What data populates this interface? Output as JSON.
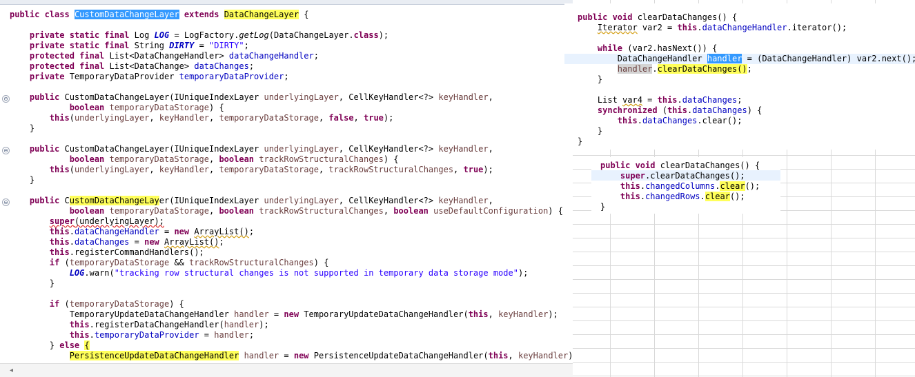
{
  "main_editor": {
    "lines": [
      [
        {
          "t": "public ",
          "c": "kw"
        },
        {
          "t": "class ",
          "c": "kw"
        },
        {
          "t": "CustomDataChangeLayer",
          "c": "sel"
        },
        {
          "t": " "
        },
        {
          "t": "extends ",
          "c": "kw"
        },
        {
          "t": "DataChangeLayer",
          "c": "hl"
        },
        {
          "t": " {"
        }
      ],
      [],
      [
        {
          "t": "    "
        },
        {
          "t": "private ",
          "c": "kw"
        },
        {
          "t": "static ",
          "c": "kw"
        },
        {
          "t": "final ",
          "c": "kw"
        },
        {
          "t": "Log "
        },
        {
          "t": "LOG",
          "c": "sfld"
        },
        {
          "t": " = LogFactory."
        },
        {
          "t": "getLog",
          "c": "sm"
        },
        {
          "t": "(DataChangeLayer."
        },
        {
          "t": "class",
          "c": "kw"
        },
        {
          "t": ");"
        }
      ],
      [
        {
          "t": "    "
        },
        {
          "t": "private ",
          "c": "kw"
        },
        {
          "t": "static ",
          "c": "kw"
        },
        {
          "t": "final ",
          "c": "kw"
        },
        {
          "t": "String "
        },
        {
          "t": "DIRTY",
          "c": "sfld"
        },
        {
          "t": " = "
        },
        {
          "t": "\"DIRTY\"",
          "c": "str"
        },
        {
          "t": ";"
        }
      ],
      [
        {
          "t": "    "
        },
        {
          "t": "protected ",
          "c": "kw"
        },
        {
          "t": "final ",
          "c": "kw"
        },
        {
          "t": "List<DataChangeHandler> "
        },
        {
          "t": "dataChangeHandler",
          "c": "fld"
        },
        {
          "t": ";"
        }
      ],
      [
        {
          "t": "    "
        },
        {
          "t": "protected ",
          "c": "kw"
        },
        {
          "t": "final ",
          "c": "kw"
        },
        {
          "t": "List<DataChange> "
        },
        {
          "t": "dataChanges",
          "c": "fld"
        },
        {
          "t": ";"
        }
      ],
      [
        {
          "t": "    "
        },
        {
          "t": "private ",
          "c": "kw"
        },
        {
          "t": "TemporaryDataProvider "
        },
        {
          "t": "temporaryDataProvider",
          "c": "fld"
        },
        {
          "t": ";"
        }
      ],
      [],
      [
        {
          "t": "    "
        },
        {
          "t": "public ",
          "c": "kw"
        },
        {
          "t": "CustomDataChangeLayer(IUniqueIndexLayer "
        },
        {
          "t": "underlyingLayer",
          "c": "par"
        },
        {
          "t": ", CellKeyHandler<?> "
        },
        {
          "t": "keyHandler",
          "c": "par"
        },
        {
          "t": ","
        }
      ],
      [
        {
          "t": "            "
        },
        {
          "t": "boolean ",
          "c": "kw"
        },
        {
          "t": "temporaryDataStorage",
          "c": "par"
        },
        {
          "t": ") {"
        }
      ],
      [
        {
          "t": "        "
        },
        {
          "t": "this",
          "c": "kw"
        },
        {
          "t": "("
        },
        {
          "t": "underlyingLayer",
          "c": "par"
        },
        {
          "t": ", "
        },
        {
          "t": "keyHandler",
          "c": "par"
        },
        {
          "t": ", "
        },
        {
          "t": "temporaryDataStorage",
          "c": "par"
        },
        {
          "t": ", "
        },
        {
          "t": "false",
          "c": "kw"
        },
        {
          "t": ", "
        },
        {
          "t": "true",
          "c": "kw"
        },
        {
          "t": ");"
        }
      ],
      [
        {
          "t": "    }"
        }
      ],
      [],
      [
        {
          "t": "    "
        },
        {
          "t": "public ",
          "c": "kw"
        },
        {
          "t": "CustomDataChangeLayer(IUniqueIndexLayer "
        },
        {
          "t": "underlyingLayer",
          "c": "par"
        },
        {
          "t": ", CellKeyHandler<?> "
        },
        {
          "t": "keyHandler",
          "c": "par"
        },
        {
          "t": ","
        }
      ],
      [
        {
          "t": "            "
        },
        {
          "t": "boolean ",
          "c": "kw"
        },
        {
          "t": "temporaryDataStorage",
          "c": "par"
        },
        {
          "t": ", "
        },
        {
          "t": "boolean ",
          "c": "kw"
        },
        {
          "t": "trackRowStructuralChanges",
          "c": "par"
        },
        {
          "t": ") {"
        }
      ],
      [
        {
          "t": "        "
        },
        {
          "t": "this",
          "c": "kw"
        },
        {
          "t": "("
        },
        {
          "t": "underlyingLayer",
          "c": "par"
        },
        {
          "t": ", "
        },
        {
          "t": "keyHandler",
          "c": "par"
        },
        {
          "t": ", "
        },
        {
          "t": "temporaryDataStorage",
          "c": "par"
        },
        {
          "t": ", "
        },
        {
          "t": "trackRowStructuralChanges",
          "c": "par"
        },
        {
          "t": ", "
        },
        {
          "t": "true",
          "c": "kw"
        },
        {
          "t": ");"
        }
      ],
      [
        {
          "t": "    }"
        }
      ],
      [],
      [
        {
          "t": "    "
        },
        {
          "t": "public ",
          "c": "kw"
        },
        {
          "t": "C"
        },
        {
          "t": "ustomDataChangeLay",
          "c": "hl"
        },
        {
          "t": "er(IUniqueIndexLayer "
        },
        {
          "t": "underlyingLayer",
          "c": "par"
        },
        {
          "t": ", CellKeyHandler<?> "
        },
        {
          "t": "keyHandler",
          "c": "par"
        },
        {
          "t": ","
        }
      ],
      [
        {
          "t": "            "
        },
        {
          "t": "boolean ",
          "c": "kw"
        },
        {
          "t": "temporaryDataStorage",
          "c": "par"
        },
        {
          "t": ", "
        },
        {
          "t": "boolean ",
          "c": "kw"
        },
        {
          "t": "trackRowStructuralChanges",
          "c": "par"
        },
        {
          "t": ", "
        },
        {
          "t": "boolean ",
          "c": "kw"
        },
        {
          "t": "useDefaultConfiguration",
          "c": "par"
        },
        {
          "t": ") {"
        }
      ],
      [
        {
          "t": "        "
        },
        {
          "t": "super",
          "c": "kw err"
        },
        {
          "t": "(underlyingLayer);",
          "c": "err"
        }
      ],
      [
        {
          "t": "        "
        },
        {
          "t": "this",
          "c": "kw"
        },
        {
          "t": "."
        },
        {
          "t": "dataChangeHandler",
          "c": "fld"
        },
        {
          "t": " = "
        },
        {
          "t": "new ",
          "c": "kw"
        },
        {
          "t": "ArrayList()",
          "c": "warn"
        },
        {
          "t": ";"
        }
      ],
      [
        {
          "t": "        "
        },
        {
          "t": "this",
          "c": "kw"
        },
        {
          "t": "."
        },
        {
          "t": "dataChanges",
          "c": "fld"
        },
        {
          "t": " = "
        },
        {
          "t": "new ",
          "c": "kw"
        },
        {
          "t": "ArrayList()",
          "c": "warn"
        },
        {
          "t": ";"
        }
      ],
      [
        {
          "t": "        "
        },
        {
          "t": "this",
          "c": "kw"
        },
        {
          "t": ".registerCommandHandlers();"
        }
      ],
      [
        {
          "t": "        "
        },
        {
          "t": "if ",
          "c": "kw"
        },
        {
          "t": "("
        },
        {
          "t": "temporaryDataStorage",
          "c": "par"
        },
        {
          "t": " && "
        },
        {
          "t": "trackRowStructuralChanges",
          "c": "par"
        },
        {
          "t": ") {"
        }
      ],
      [
        {
          "t": "            "
        },
        {
          "t": "LOG",
          "c": "sfld"
        },
        {
          "t": ".warn("
        },
        {
          "t": "\"tracking row structural changes is not supported in temporary data storage mode\"",
          "c": "str"
        },
        {
          "t": ");"
        }
      ],
      [
        {
          "t": "        }"
        }
      ],
      [],
      [
        {
          "t": "        "
        },
        {
          "t": "if ",
          "c": "kw"
        },
        {
          "t": "("
        },
        {
          "t": "temporaryDataStorage",
          "c": "par"
        },
        {
          "t": ") {"
        }
      ],
      [
        {
          "t": "            TemporaryUpdateDataChangeHandler "
        },
        {
          "t": "handler",
          "c": "par"
        },
        {
          "t": " = "
        },
        {
          "t": "new ",
          "c": "kw"
        },
        {
          "t": "TemporaryUpdateDataChangeHandler("
        },
        {
          "t": "this",
          "c": "kw"
        },
        {
          "t": ", "
        },
        {
          "t": "keyHandler",
          "c": "par"
        },
        {
          "t": ");"
        }
      ],
      [
        {
          "t": "            "
        },
        {
          "t": "this",
          "c": "kw"
        },
        {
          "t": ".registerDataChangeHandler("
        },
        {
          "t": "handler",
          "c": "par"
        },
        {
          "t": ");"
        }
      ],
      [
        {
          "t": "            "
        },
        {
          "t": "this",
          "c": "kw"
        },
        {
          "t": "."
        },
        {
          "t": "temporaryDataProvider",
          "c": "fld"
        },
        {
          "t": " = "
        },
        {
          "t": "handler",
          "c": "par"
        },
        {
          "t": ";"
        }
      ],
      [
        {
          "t": "        } "
        },
        {
          "t": "else ",
          "c": "kw"
        },
        {
          "t": "{",
          "c": "hl"
        }
      ],
      [
        {
          "t": "            "
        },
        {
          "t": "PersistenceUpdateDataChangeHandler",
          "c": "hl"
        },
        {
          "t": " "
        },
        {
          "t": "handler",
          "c": "par"
        },
        {
          "t": " = "
        },
        {
          "t": "new ",
          "c": "kw"
        },
        {
          "t": "PersistenceUpdateDataChangeHandler("
        },
        {
          "t": "this",
          "c": "kw"
        },
        {
          "t": ", "
        },
        {
          "t": "keyHandler",
          "c": "par"
        },
        {
          "t": ");"
        }
      ]
    ]
  },
  "decompiled_snippet": {
    "lines": [
      [
        {
          "t": "public ",
          "c": "kw"
        },
        {
          "t": "void ",
          "c": "kw"
        },
        {
          "t": "clearDataChanges() {"
        }
      ],
      [
        {
          "t": "    "
        },
        {
          "t": "Iterator",
          "c": "warn"
        },
        {
          "t": " var2 = "
        },
        {
          "t": "this",
          "c": "kw"
        },
        {
          "t": "."
        },
        {
          "t": "dataChangeHandler",
          "c": "fld"
        },
        {
          "t": ".iterator();"
        }
      ],
      [],
      [
        {
          "t": "    "
        },
        {
          "t": "while ",
          "c": "kw"
        },
        {
          "t": "(var2.hasNext()) {"
        }
      ],
      [
        {
          "t": "        DataChangeHandler "
        },
        {
          "t": "handler",
          "c": "sel"
        },
        {
          "t": " = (DataChangeHandler) var2.next();"
        }
      ],
      [
        {
          "t": "        "
        },
        {
          "t": "handler",
          "c": "par occ"
        },
        {
          "t": "."
        },
        {
          "t": "clearDataChanges()",
          "c": "hl"
        },
        {
          "t": ";"
        }
      ],
      [
        {
          "t": "    }"
        }
      ],
      [],
      [
        {
          "t": "    List "
        },
        {
          "t": "var4",
          "c": "warn"
        },
        {
          "t": " = "
        },
        {
          "t": "this",
          "c": "kw"
        },
        {
          "t": "."
        },
        {
          "t": "dataChanges",
          "c": "fld"
        },
        {
          "t": ";"
        }
      ],
      [
        {
          "t": "    "
        },
        {
          "t": "synchronized ",
          "c": "kw"
        },
        {
          "t": "("
        },
        {
          "t": "this",
          "c": "kw"
        },
        {
          "t": "."
        },
        {
          "t": "dataChanges",
          "c": "fld"
        },
        {
          "t": ") {"
        }
      ],
      [
        {
          "t": "        "
        },
        {
          "t": "this",
          "c": "kw"
        },
        {
          "t": "."
        },
        {
          "t": "dataChanges",
          "c": "fld"
        },
        {
          "t": ".clear();"
        }
      ],
      [
        {
          "t": "    }"
        }
      ],
      [
        {
          "t": "}"
        }
      ]
    ]
  },
  "override_snippet": {
    "lines": [
      [
        {
          "t": "public ",
          "c": "kw"
        },
        {
          "t": "void ",
          "c": "kw"
        },
        {
          "t": "clearDataChanges() {"
        }
      ],
      [
        {
          "t": "    "
        },
        {
          "t": "super",
          "c": "kw"
        },
        {
          "t": ".clearDataChanges();"
        }
      ],
      [
        {
          "t": "    "
        },
        {
          "t": "this",
          "c": "kw"
        },
        {
          "t": "."
        },
        {
          "t": "changedColumns",
          "c": "fld"
        },
        {
          "t": "."
        },
        {
          "t": "clear",
          "c": "hl"
        },
        {
          "t": "();"
        }
      ],
      [
        {
          "t": "    "
        },
        {
          "t": "this",
          "c": "kw"
        },
        {
          "t": "."
        },
        {
          "t": "changedRows",
          "c": "fld"
        },
        {
          "t": "."
        },
        {
          "t": "clear",
          "c": "hl"
        },
        {
          "t": "();"
        }
      ],
      [
        {
          "t": "}"
        }
      ]
    ]
  },
  "fold_markers": [
    "⊖",
    "⊖",
    "⊖"
  ],
  "scroll_arrow": "◂"
}
